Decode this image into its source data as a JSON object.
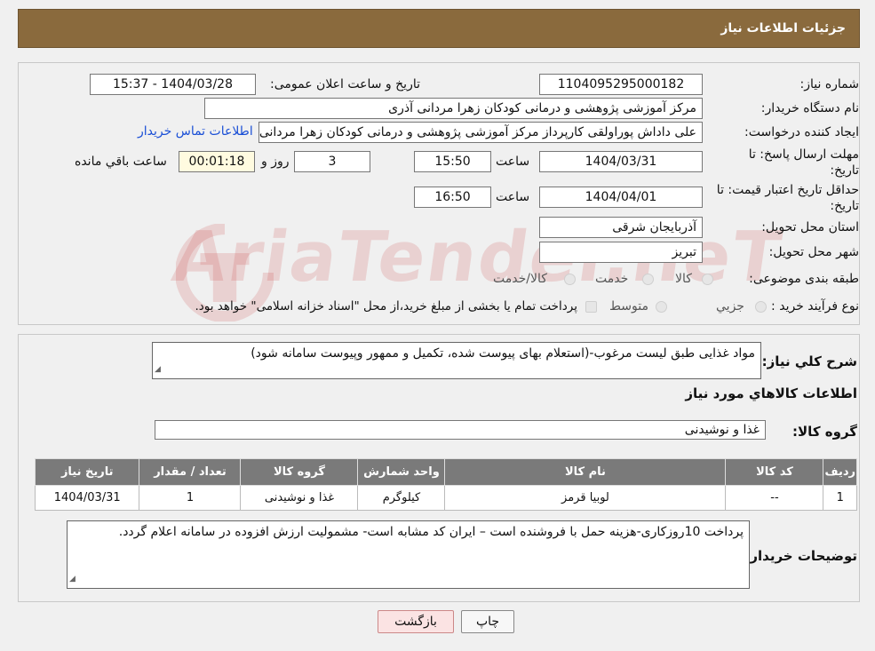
{
  "header": {
    "title": "جزئیات اطلاعات نیاز"
  },
  "form": {
    "need_number_label": "شماره نیاز:",
    "need_number": "1104095295000182",
    "announce_label": "تاریخ و ساعت اعلان عمومی:",
    "announce_value": "1404/03/28 - 15:37",
    "buyer_org_label": "نام دستگاه خریدار:",
    "buyer_org": "مرکز آموزشی پژوهشی و درمانی کودکان زهرا مردانی آذری",
    "creator_label": "ایجاد کننده درخواست:",
    "creator": "علی داداش پوراولقی کارپرداز مرکز آموزشی پژوهشی و درمانی کودکان زهرا مردانی آذری",
    "contact_link": "اطلاعات تماس خریدار",
    "deadline_label": "مهلت ارسال پاسخ: تا تاریخ:",
    "deadline_date": "1404/03/31",
    "time_label": "ساعت",
    "deadline_time": "15:50",
    "days": "3",
    "days_label": "روز و",
    "remaining": "00:01:18",
    "remaining_label": "ساعت باقي مانده",
    "validity_label": "حداقل تاریخ اعتبار قیمت: تا تاریخ:",
    "validity_date": "1404/04/01",
    "validity_time": "16:50",
    "province_label": "استان محل تحویل:",
    "province": "آذربایجان شرقی",
    "city_label": "شهر محل تحویل:",
    "city": "تبریز",
    "category_label": "طبقه بندی موضوعی:",
    "category_options": [
      "کالا",
      "خدمت",
      "کالا/خدمت"
    ],
    "process_label": "نوع فرآیند خرید :",
    "process_options": [
      "جزیي",
      "متوسط"
    ],
    "process_note": "پرداخت تمام یا بخشی از مبلغ خرید،از محل \"اسناد خزانه اسلامی\" خواهد بود."
  },
  "description": {
    "label": "شرح کلي نياز:",
    "text": "مواد غذایی طبق لیست مرغوب-(استعلام بهای پیوست شده،  تکمیل و ممهور وپیوست سامانه  شود)"
  },
  "goods": {
    "section_title": "اطلاعات کالاهاي مورد نياز",
    "group_label": "گروه کالا:",
    "group_value": "غذا و نوشیدنی",
    "columns": [
      "رديف",
      "کد کالا",
      "نام کالا",
      "واحد شمارش",
      "گروه کالا",
      "تعداد / مقدار",
      "تاریخ نیاز"
    ],
    "rows": [
      [
        "1",
        "--",
        "لوبیا قرمز",
        "کیلوگرم",
        "غذا و نوشیدنی",
        "1",
        "1404/03/31"
      ]
    ]
  },
  "buyer_notes": {
    "label": "توضیحات خریدار:",
    "text": "پرداخت 10روزکاری-هزینه حمل با فروشنده است – ایران کد مشابه است- مشمولیت ارزش افزوده در سامانه  اعلام  گردد."
  },
  "buttons": {
    "print": "چاپ",
    "back": "بازگشت"
  },
  "watermark": "AriaTender.neT",
  "colors": {
    "header": "#8a6a3d",
    "table_header": "#7a7a7a",
    "link": "#1a4fd6"
  }
}
